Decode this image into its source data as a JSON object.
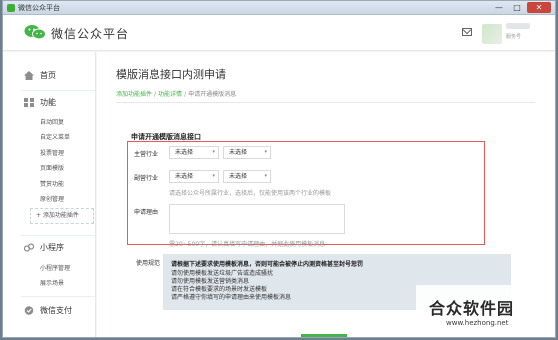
{
  "window": {
    "title": "微信公众平台",
    "controls": {
      "minimize": "—",
      "maximize": "□",
      "close": "✕"
    }
  },
  "header": {
    "logo_text": "微信公众平台",
    "account_type": "服务号"
  },
  "sidebar": {
    "home": "首页",
    "features": {
      "label": "功能",
      "items": [
        "自动回复",
        "自定义菜单",
        "投票管理",
        "页面模版",
        "赞赏功能",
        "原创管理"
      ]
    },
    "add_plugin": "+ 添加功能插件",
    "mini_program": {
      "label": "小程序",
      "items": [
        "小程序管理",
        "展示场景"
      ]
    },
    "wechat_pay": "微信支付"
  },
  "main": {
    "title": "模版消息接口内测申请",
    "breadcrumb": {
      "link1": "添加功能插件",
      "sep": "/",
      "link2": "功能详情",
      "current": "申请开通模版消息"
    },
    "form": {
      "section_title": "申请开通模版消息接口",
      "main_industry": {
        "label": "主营行业",
        "select1": "未选择",
        "select2": "未选择"
      },
      "secondary_industry": {
        "label": "副营行业",
        "select1": "未选择",
        "select2": "未选择",
        "hint": "请选择公众号所属行业，选择后，仅能使用该两个行业的模板"
      },
      "reason": {
        "label": "申请理由",
        "hint": "需20~500字，请认真填写申请理由，并据此使用模板消息"
      }
    },
    "rules": {
      "label": "使用规范",
      "warning": "请根据下述要求使用模板消息，否则可能会被停止内测资格甚至封号惩罚",
      "lines": [
        "请勿使用模板发送垃圾广告或造成骚扰",
        "请勿使用模板发送营销类消息",
        "请在符合模板要求的场景时发送模板",
        "请严格遵守你填写的申请理由来使用模板消息"
      ]
    }
  },
  "watermark": {
    "main": "合众软件园",
    "url": "www.hezhong.net"
  },
  "colors": {
    "accent_green": "#44b549",
    "highlight_red": "#e35b5b",
    "notice_bg": "#dfe6ec"
  }
}
